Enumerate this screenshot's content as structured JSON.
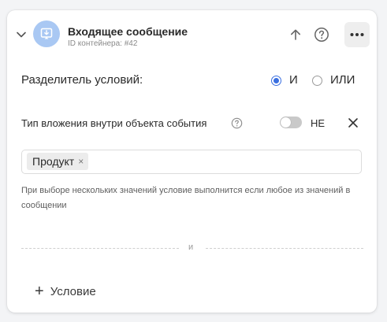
{
  "header": {
    "title": "Входящее сообщение",
    "subtitle": "ID контейнера: #42",
    "icon_color": "#a9c8f3"
  },
  "separator": {
    "label": "Разделитель условий:",
    "options": [
      {
        "label": "И",
        "selected": true
      },
      {
        "label": "ИЛИ",
        "selected": false
      }
    ],
    "accent": "#3a6fe0"
  },
  "attachment": {
    "label": "Тип вложения внутри объекта события",
    "toggle_on": false,
    "toggle_label": "НЕ"
  },
  "values": {
    "tags": [
      "Продукт"
    ],
    "tag_remove_glyph": "×",
    "hint": "При выборе нескольких значений условие выполнится если любое из значений в сообщении"
  },
  "divider": {
    "label": "и"
  },
  "add_condition": {
    "plus": "+",
    "label": "Условие"
  },
  "icons": [
    "chevron-down-icon",
    "message-in-icon",
    "arrow-up-icon",
    "help-icon",
    "more-icon",
    "close-icon"
  ]
}
